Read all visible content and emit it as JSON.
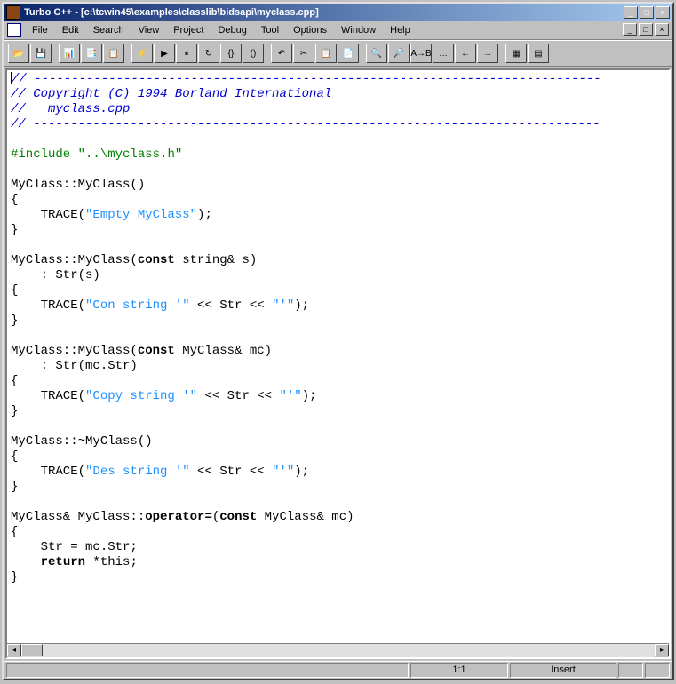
{
  "title": "Turbo C++ - [c:\\tcwin45\\examples\\classlib\\bidsapi\\myclass.cpp]",
  "menu": {
    "file": "File",
    "edit": "Edit",
    "search": "Search",
    "view": "View",
    "project": "Project",
    "debug": "Debug",
    "tool": "Tool",
    "options": "Options",
    "window": "Window",
    "help": "Help"
  },
  "win_buttons": {
    "min": "_",
    "max": "□",
    "close": "×"
  },
  "toolbar_icons": {
    "b1": "📂",
    "b2": "💾",
    "b3": "📊",
    "b4": "📑",
    "b5": "📋",
    "b6": "⚡",
    "b7": "▶",
    "b8": "⏸",
    "b9": "↻",
    "b10": "{}",
    "b11": "()",
    "b12": "↶",
    "b13": "✂",
    "b14": "📋",
    "b15": "📄",
    "b16": "🔍",
    "b17": "🔎",
    "b18": "A→B",
    "b19": "…",
    "b20": "←",
    "b21": "→",
    "b22": "▦",
    "b23": "▤"
  },
  "code": {
    "dash1": "// ----------------------------------------------------------------------------",
    "copy": "// Copyright (C) 1994 Borland International",
    "fname": "//   myclass.cpp",
    "dash2": "// ----------------------------------------------------------------------------",
    "inc_kw": "#include ",
    "inc_str": "\"..\\myclass.h\"",
    "l1": "MyClass::MyClass()",
    "lb": "{",
    "rb": "}",
    "t1a": "    TRACE(",
    "t1b": "\"Empty MyClass\"",
    "t1c": ");",
    "l2a": "MyClass::MyClass(",
    "kw_const": "const",
    "l2b": " string& s)",
    "init1": "    : Str(s)",
    "t2a": "    TRACE(",
    "t2b": "\"Con string '\"",
    "t2c": " << Str << ",
    "t2d": "\"'\"",
    "t2e": ");",
    "l3b": " MyClass& mc)",
    "init2": "    : Str(mc.Str)",
    "t3b": "\"Copy string '\"",
    "l4": "MyClass::~MyClass()",
    "t4b": "\"Des string '\"",
    "l5a": "MyClass& MyClass::",
    "kw_op": "operator=",
    "l5b": "(",
    "assign": "    Str = mc.Str;",
    "ret_sp": "    ",
    "kw_ret": "return",
    "ret_v": " *this;"
  },
  "status": {
    "pos": "1:1",
    "mode": "Insert"
  }
}
